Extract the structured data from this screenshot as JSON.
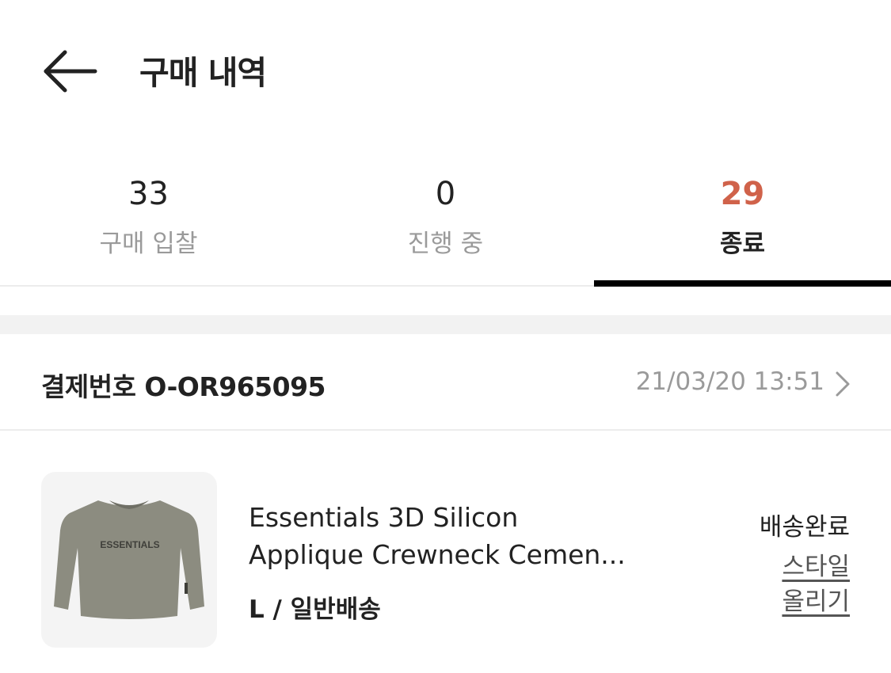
{
  "header": {
    "title": "구매 내역",
    "back_icon": "arrow-left-icon"
  },
  "tabs": [
    {
      "count": "33",
      "label": "구매 입찰",
      "active": false
    },
    {
      "count": "0",
      "label": "진행 중",
      "active": false
    },
    {
      "count": "29",
      "label": "종료",
      "active": true
    }
  ],
  "colors": {
    "accent": "#d0624a",
    "indicator": "#000000",
    "muted": "#9a9a9a"
  },
  "order": {
    "number_label": "결제번호 O-OR965095",
    "date": "21/03/20 13:51",
    "chevron_icon": "chevron-right-icon"
  },
  "item": {
    "name_line1": "Essentials 3D Silicon",
    "name_line2": "Applique Crewneck Cemen...",
    "option": "L / 일반배송",
    "status": "배송완료",
    "style_link_line1": "스타일",
    "style_link_line2": "올리기",
    "image_print": "ESSENTIALS"
  }
}
